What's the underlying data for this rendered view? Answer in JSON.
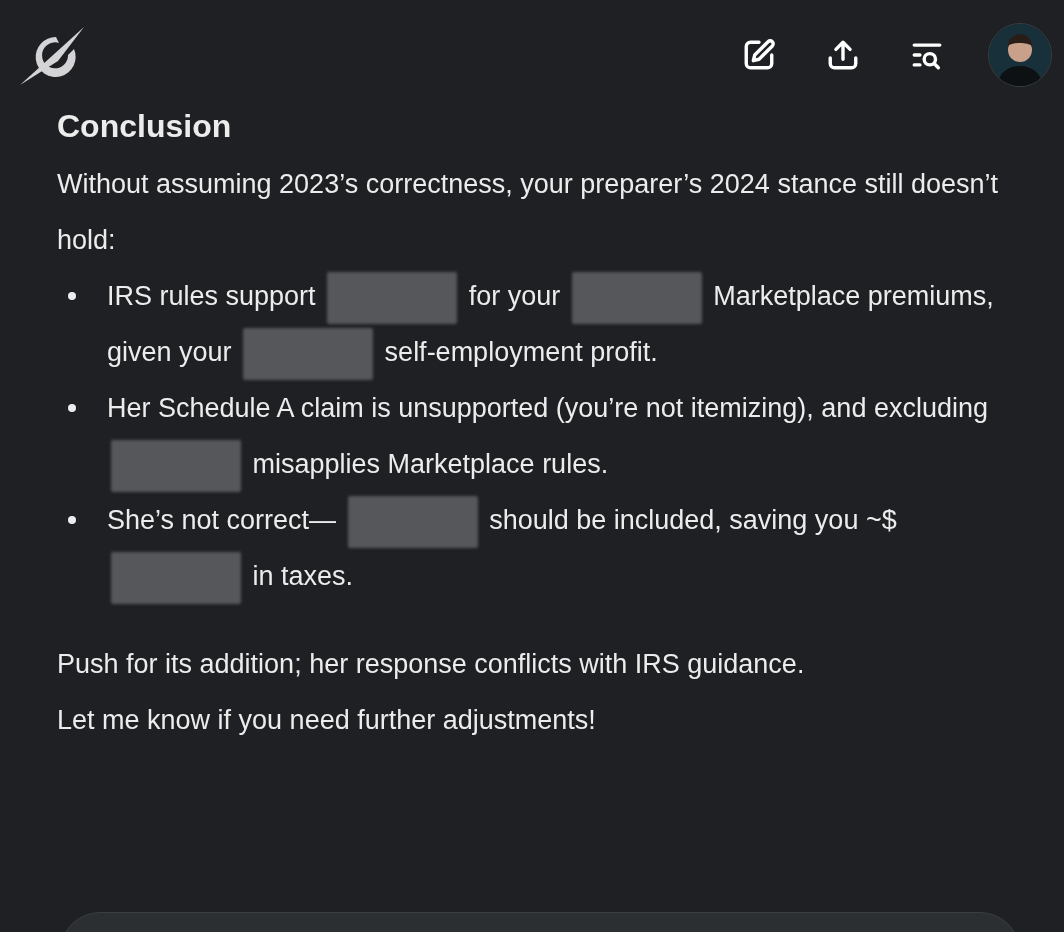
{
  "header": {
    "actions": [
      {
        "kind": "edit"
      },
      {
        "kind": "share"
      },
      {
        "kind": "search-list"
      }
    ]
  },
  "message": {
    "heading": "Conclusion",
    "intro": "Without assuming 2023’s correctness, your preparer’s 2024 stance still doesn’t hold:",
    "bullets": [
      {
        "segments": [
          {
            "kind": "text",
            "text": "IRS rules support"
          },
          {
            "kind": "redacted"
          },
          {
            "kind": "text",
            "text": "for your"
          },
          {
            "kind": "redacted"
          },
          {
            "kind": "text",
            "text": "Marketplace premiums, given your"
          },
          {
            "kind": "redacted"
          },
          {
            "kind": "text",
            "text": "self-employment profit."
          }
        ]
      },
      {
        "segments": [
          {
            "kind": "text",
            "text": "Her Schedule A claim is unsupported (you’re not itemizing), and excluding"
          },
          {
            "kind": "redacted"
          },
          {
            "kind": "text",
            "text": "misapplies Marketplace rules."
          }
        ]
      },
      {
        "segments": [
          {
            "kind": "text",
            "text": "She’s not correct—"
          },
          {
            "kind": "redacted"
          },
          {
            "kind": "text",
            "text": "should be included, saving you ~$"
          },
          {
            "kind": "redacted"
          },
          {
            "kind": "text",
            "text": "in taxes."
          }
        ]
      }
    ],
    "closing": [
      "Push for its addition; her response conflicts with IRS guidance.",
      "Let me know if you need further adjustments!"
    ]
  }
}
